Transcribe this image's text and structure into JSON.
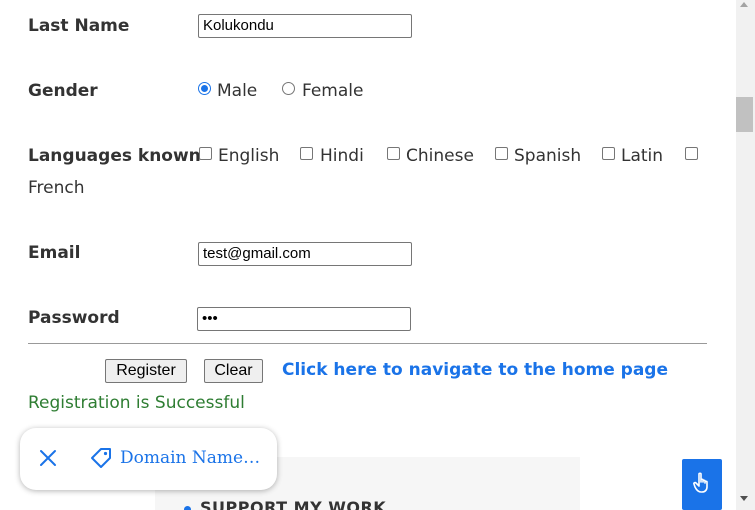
{
  "form": {
    "last_name_label": "Last Name",
    "last_name_value": "Kolukondu",
    "gender_label": "Gender",
    "gender_options": [
      "Male",
      "Female"
    ],
    "gender_selected": "Male",
    "languages_label": "Languages known",
    "languages": [
      "English",
      "Hindi",
      "Chinese",
      "Spanish",
      "Latin",
      "French"
    ],
    "email_label": "Email",
    "email_value": "test@gmail.com",
    "password_label": "Password",
    "password_value": "•••"
  },
  "actions": {
    "register_label": "Register",
    "clear_label": "Clear",
    "home_link": "Click here to navigate to the home page"
  },
  "status": {
    "message": "Registration is Successful"
  },
  "footer": {
    "support_heading": "SUPPORT MY WORK"
  },
  "chip": {
    "label": "Domain Name…"
  },
  "colors": {
    "accent": "#1a73e8",
    "success": "#2e7d32"
  },
  "icons": {
    "close": "close-icon",
    "tag": "tag-icon",
    "pointer": "hand-pointer-icon"
  }
}
